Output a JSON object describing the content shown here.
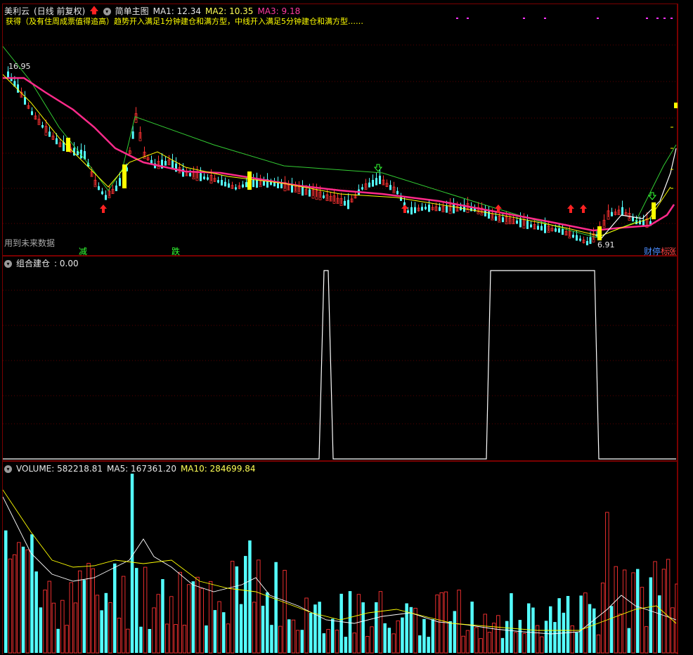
{
  "main_panel": {
    "stock_name": "美利云",
    "period_label": "(日线 前复权)",
    "indicator_name": "简单主图",
    "ma1": "MA1: 12.34",
    "ma2": "MA2: 10.35",
    "ma3": "MA3: 9.18",
    "scroll_text": "获得（及有住周成票值得追高）趋势开入满足1分钟建仓和满方型，中线开入满足5分钟建仓和满方型……",
    "high_label": "16.95",
    "low_label": "6.91",
    "future_data_note": "用到未来数据",
    "marker_jian": "减",
    "marker_die": "跌",
    "marker_caifu": "财",
    "marker_ting": "停",
    "marker_zhang": "涨",
    "marker_biao": "标"
  },
  "position_panel": {
    "title": "组合建仓",
    "value": ": 0.00"
  },
  "volume_panel": {
    "volume": "VOLUME: 582218.81",
    "ma5": "MA5: 167361.20",
    "ma10": "MA10: 284699.84"
  },
  "colors": {
    "up": "#ff3333",
    "down": "#54ffff",
    "ma_main": "#ff2a8a",
    "ma_green": "#33cc33",
    "ma_yellow": "#ffff00",
    "border": "#7a0000"
  },
  "icons": {
    "up_arrow": "red-up-arrow-icon",
    "down_arrow": "green-down-arrow-icon",
    "collapse": "circle-chevron-icon"
  }
}
